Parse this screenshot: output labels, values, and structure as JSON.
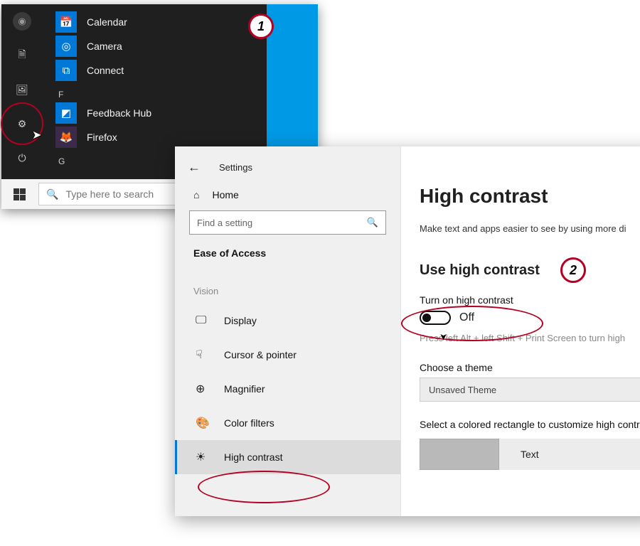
{
  "annotations": {
    "step1": "1",
    "step2": "2"
  },
  "start": {
    "apps": {
      "calendar": "Calendar",
      "camera": "Camera",
      "connect": "Connect",
      "section_f": "F",
      "feedback": "Feedback Hub",
      "firefox": "Firefox",
      "section_g": "G"
    },
    "search_placeholder": "Type here to search"
  },
  "settings": {
    "title": "Settings",
    "home": "Home",
    "search_placeholder": "Find a setting",
    "category": "Ease of Access",
    "group_vision": "Vision",
    "nav": {
      "display": "Display",
      "cursor": "Cursor & pointer",
      "magnifier": "Magnifier",
      "colorfilters": "Color filters",
      "highcontrast": "High contrast"
    },
    "page": {
      "heading": "High contrast",
      "sub": "Make text and apps easier to see by using more di",
      "use_heading": "Use high contrast",
      "toggle_label": "Turn on high contrast",
      "toggle_state": "Off",
      "hint": "Press left Alt + left Shift + Print Screen to turn high",
      "choose_theme": "Choose a theme",
      "theme_value": "Unsaved Theme",
      "customize": "Select a colored rectangle to customize high contr",
      "swatch_text": "Text"
    }
  }
}
